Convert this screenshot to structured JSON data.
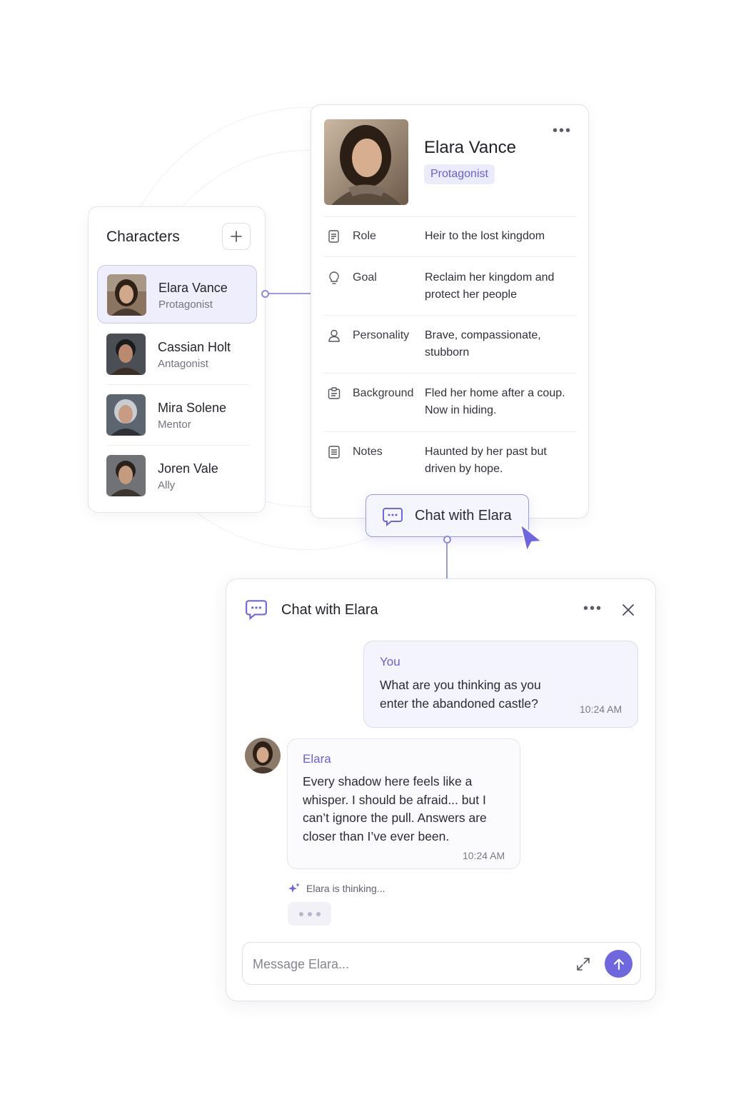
{
  "colors": {
    "accent": "#6e67df",
    "accent_soft": "#eeeefc",
    "border": "#e2e2ea"
  },
  "characters": {
    "title": "Characters",
    "add_icon": "plus-icon",
    "items": [
      {
        "name": "Elara Vance",
        "role": "Protagonist",
        "active": true
      },
      {
        "name": "Cassian Holt",
        "role": "Antagonist",
        "active": false
      },
      {
        "name": "Mira Solene",
        "role": "Mentor",
        "active": false
      },
      {
        "name": "Joren Vale",
        "role": "Ally",
        "active": false
      }
    ]
  },
  "profile": {
    "name": "Elara Vance",
    "badge": "Protagonist",
    "more_icon": "more-horizontal-icon",
    "fields": [
      {
        "icon": "note-edit-icon",
        "label": "Role",
        "value": "Heir to the lost kingdom"
      },
      {
        "icon": "lightbulb-icon",
        "label": "Goal",
        "value": "Reclaim her kingdom and protect her people"
      },
      {
        "icon": "user-icon",
        "label": "Personality",
        "value": "Brave, compassionate, stubborn"
      },
      {
        "icon": "clipboard-icon",
        "label": "Background",
        "value": "Fled her home after a coup. Now in hiding."
      },
      {
        "icon": "document-icon",
        "label": "Notes",
        "value": "Haunted by her past but driven by hope."
      }
    ],
    "chat_button": "Chat with Elara"
  },
  "chat": {
    "title": "Chat with Elara",
    "messages": [
      {
        "sender": "You",
        "text": "What are you thinking as you enter the abandoned castle?",
        "time": "10:24 AM"
      },
      {
        "sender": "Elara",
        "text": "Every shadow here feels like a whisper. I should be afraid... but I can’t ignore the pull. Answers are closer than I’ve ever been.",
        "time": "10:24 AM"
      }
    ],
    "thinking": "Elara is thinking...",
    "input_placeholder": "Message Elara...",
    "input_value": ""
  }
}
